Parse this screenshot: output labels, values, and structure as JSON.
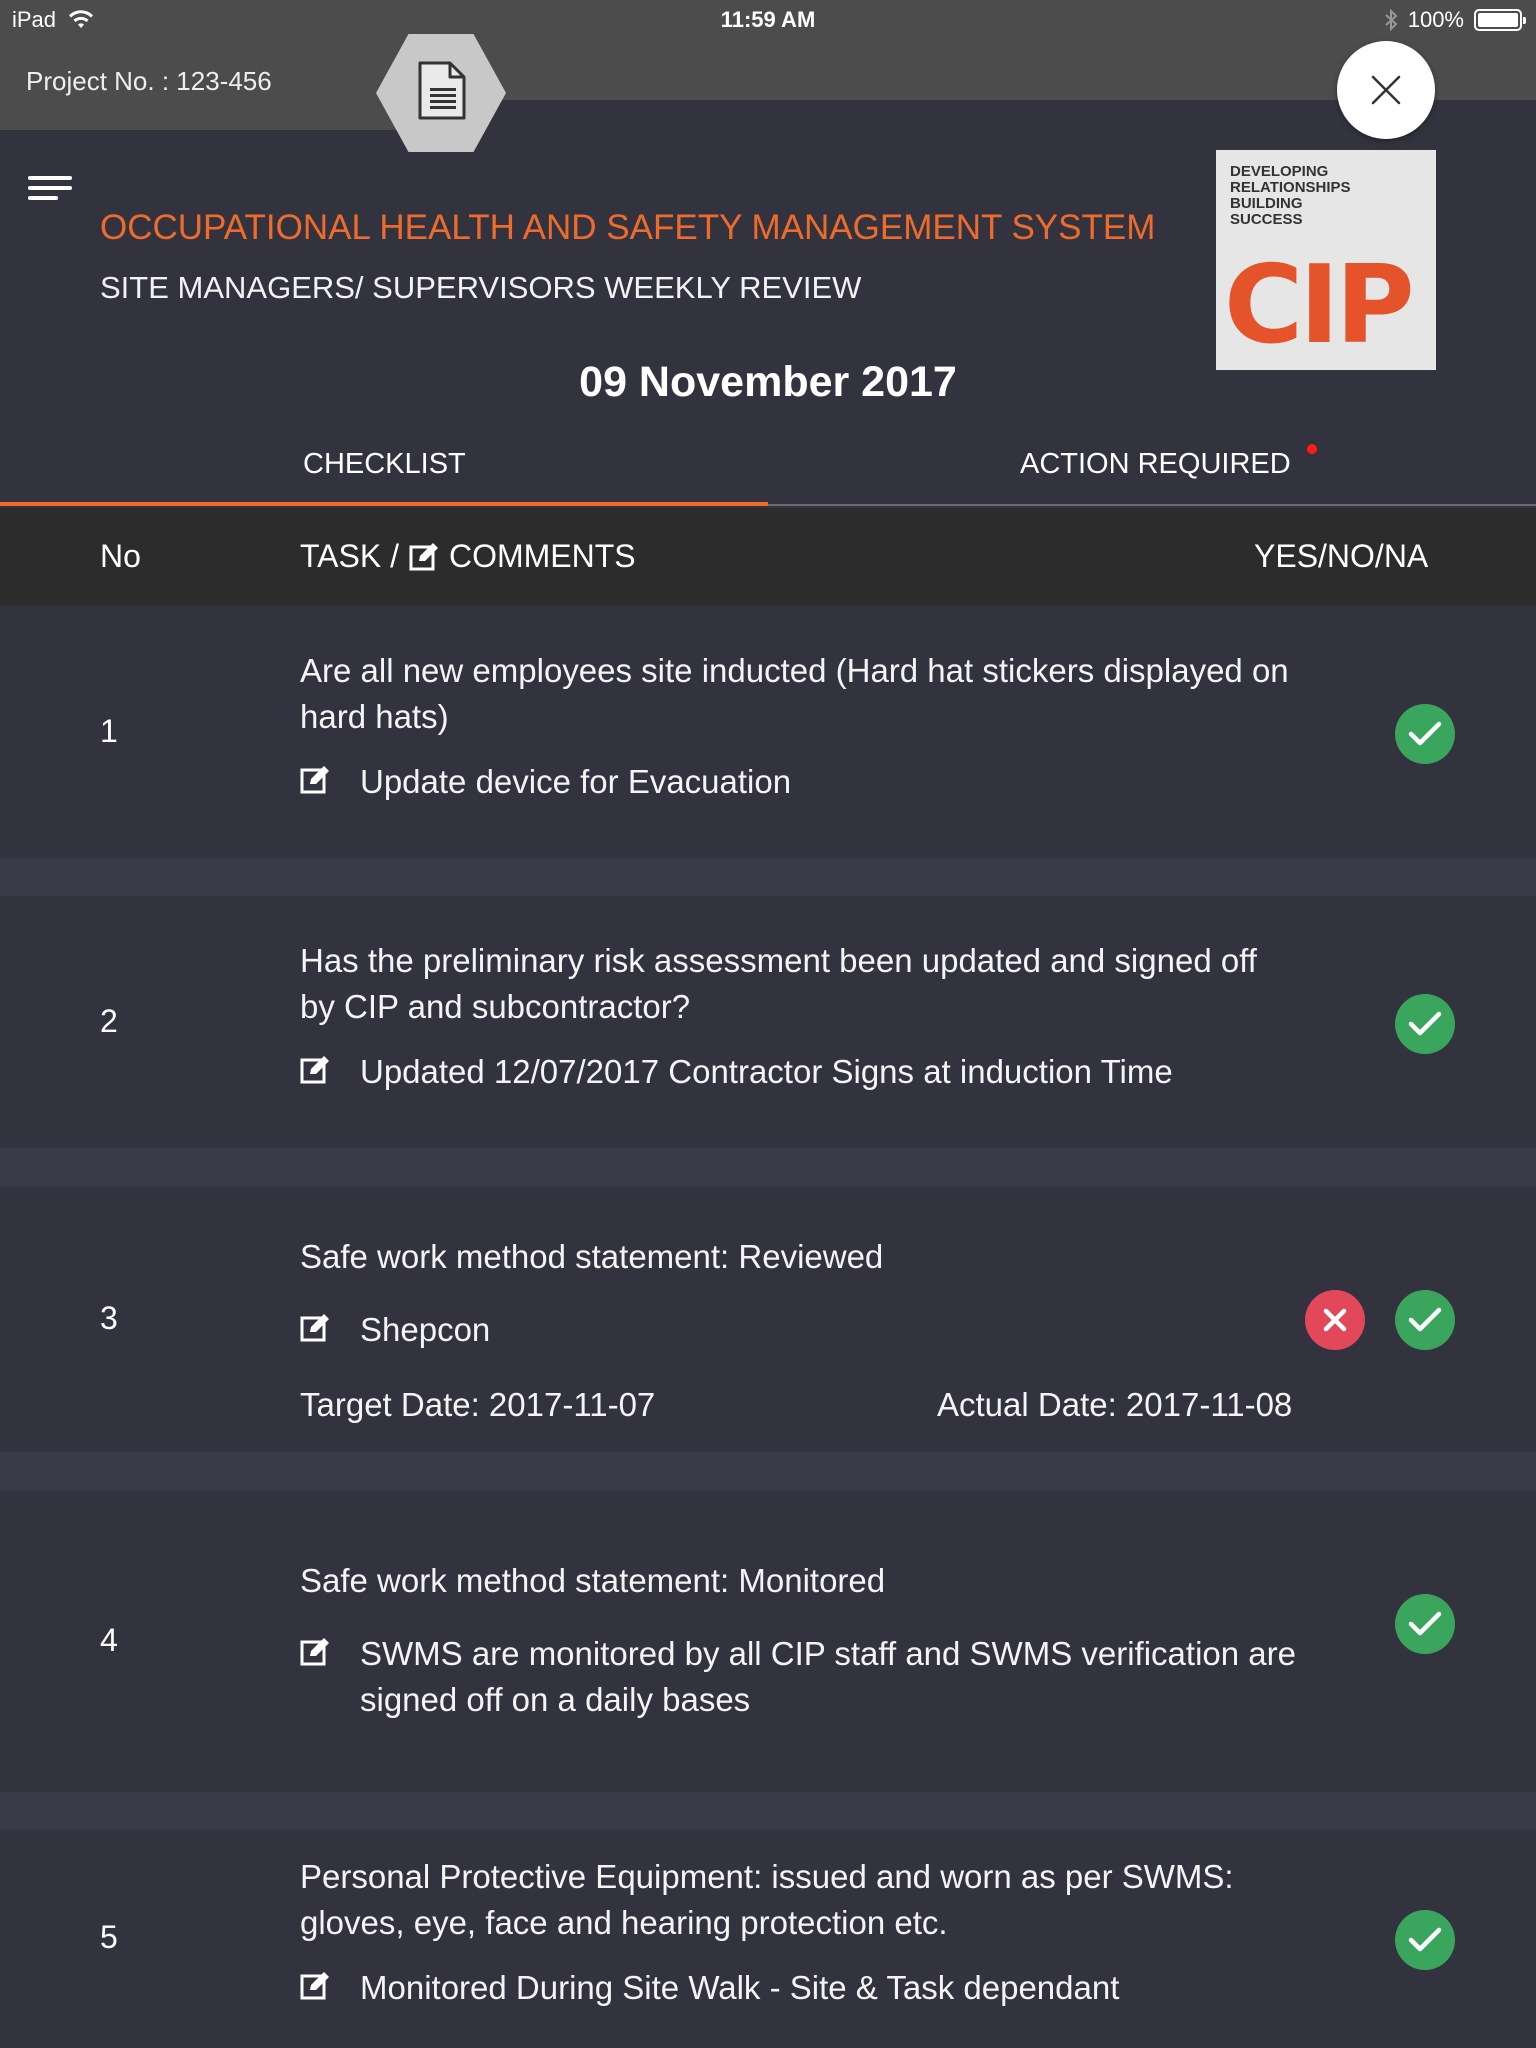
{
  "status_bar": {
    "device": "iPad",
    "time": "11:59 AM",
    "battery": "100%"
  },
  "project": {
    "label": "Project No. : 123-456"
  },
  "header": {
    "title": "OCCUPATIONAL HEALTH AND SAFETY MANAGEMENT SYSTEM",
    "subtitle": "SITE MANAGERS/ SUPERVISORS WEEKLY REVIEW",
    "date": "09 November 2017"
  },
  "logo": {
    "tagline": [
      "DEVELOPING",
      "RELATIONSHIPS",
      "BUILDING",
      "SUCCESS"
    ],
    "wordmark": "CIP"
  },
  "tabs": [
    {
      "label": "CHECKLIST",
      "active": true
    },
    {
      "label": "ACTION REQUIRED",
      "active": false
    }
  ],
  "table_header": {
    "no": "No",
    "task_prefix": "TASK /",
    "task_suffix": "COMMENTS",
    "status": "YES/NO/NA"
  },
  "rows": [
    {
      "no": "1",
      "task": "Are all new employees site inducted (Hard hat stickers displayed on hard hats)",
      "comment": "Update device for Evacuation",
      "status": [
        "yes"
      ]
    },
    {
      "no": "2",
      "task": "Has the preliminary risk assessment been updated and signed off by CIP and subcontractor?",
      "comment": "Updated 12/07/2017 Contractor Signs at induction Time",
      "status": [
        "yes"
      ]
    },
    {
      "no": "3",
      "task": "Safe work method statement: Reviewed",
      "comment": "Shepcon",
      "target_date": "Target Date: 2017-11-07",
      "actual_date": "Actual Date: 2017-11-08",
      "status": [
        "no",
        "yes"
      ]
    },
    {
      "no": "4",
      "task": "Safe work method statement: Monitored",
      "comment": "SWMS are monitored by all CIP staff and SWMS verification are signed off on a daily bases",
      "status": [
        "yes"
      ]
    },
    {
      "no": "5",
      "task": "Personal Protective Equipment: issued and worn as per SWMS: gloves, eye, face and hearing protection etc.",
      "comment": "Monitored During Site Walk - Site & Task dependant",
      "status": [
        "yes"
      ]
    }
  ],
  "colors": {
    "accent": "#ee6c2b",
    "background": "#33333f",
    "yes": "#3aa55d",
    "no": "#e2475a"
  }
}
